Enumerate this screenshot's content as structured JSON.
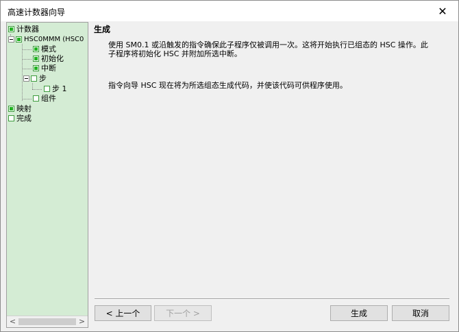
{
  "window": {
    "title": "高速计数器向导",
    "close_glyph": "✕"
  },
  "tree": {
    "items": [
      {
        "label": "计数器",
        "checked": true
      },
      {
        "label": "HSC0MMM (HSC0",
        "checked": true
      },
      {
        "label": "模式",
        "checked": true
      },
      {
        "label": "初始化",
        "checked": true
      },
      {
        "label": "中断",
        "checked": true
      },
      {
        "label": "步",
        "checked": false
      },
      {
        "label": "步 1",
        "checked": false
      },
      {
        "label": "组件",
        "checked": false
      },
      {
        "label": "映射",
        "checked": true
      },
      {
        "label": "完成",
        "checked": false
      }
    ],
    "scroll_left": "<",
    "scroll_right": ">"
  },
  "content": {
    "title": "生成",
    "paragraph1": "使用 SM0.1 或沿触发的指令确保此子程序仅被调用一次。这将开始执行已组态的 HSC 操作。此子程序将初始化 HSC 并附加所选中断。",
    "paragraph2": "指令向导 HSC 现在将为所选组态生成代码，并使该代码可供程序使用。"
  },
  "buttons": {
    "prev": "< 上一个",
    "next": "下一个 >",
    "generate": "生成",
    "cancel": "取消"
  },
  "colors": {
    "tree_background": "#d4ecd4",
    "checkbox_fill": "#22b322"
  }
}
